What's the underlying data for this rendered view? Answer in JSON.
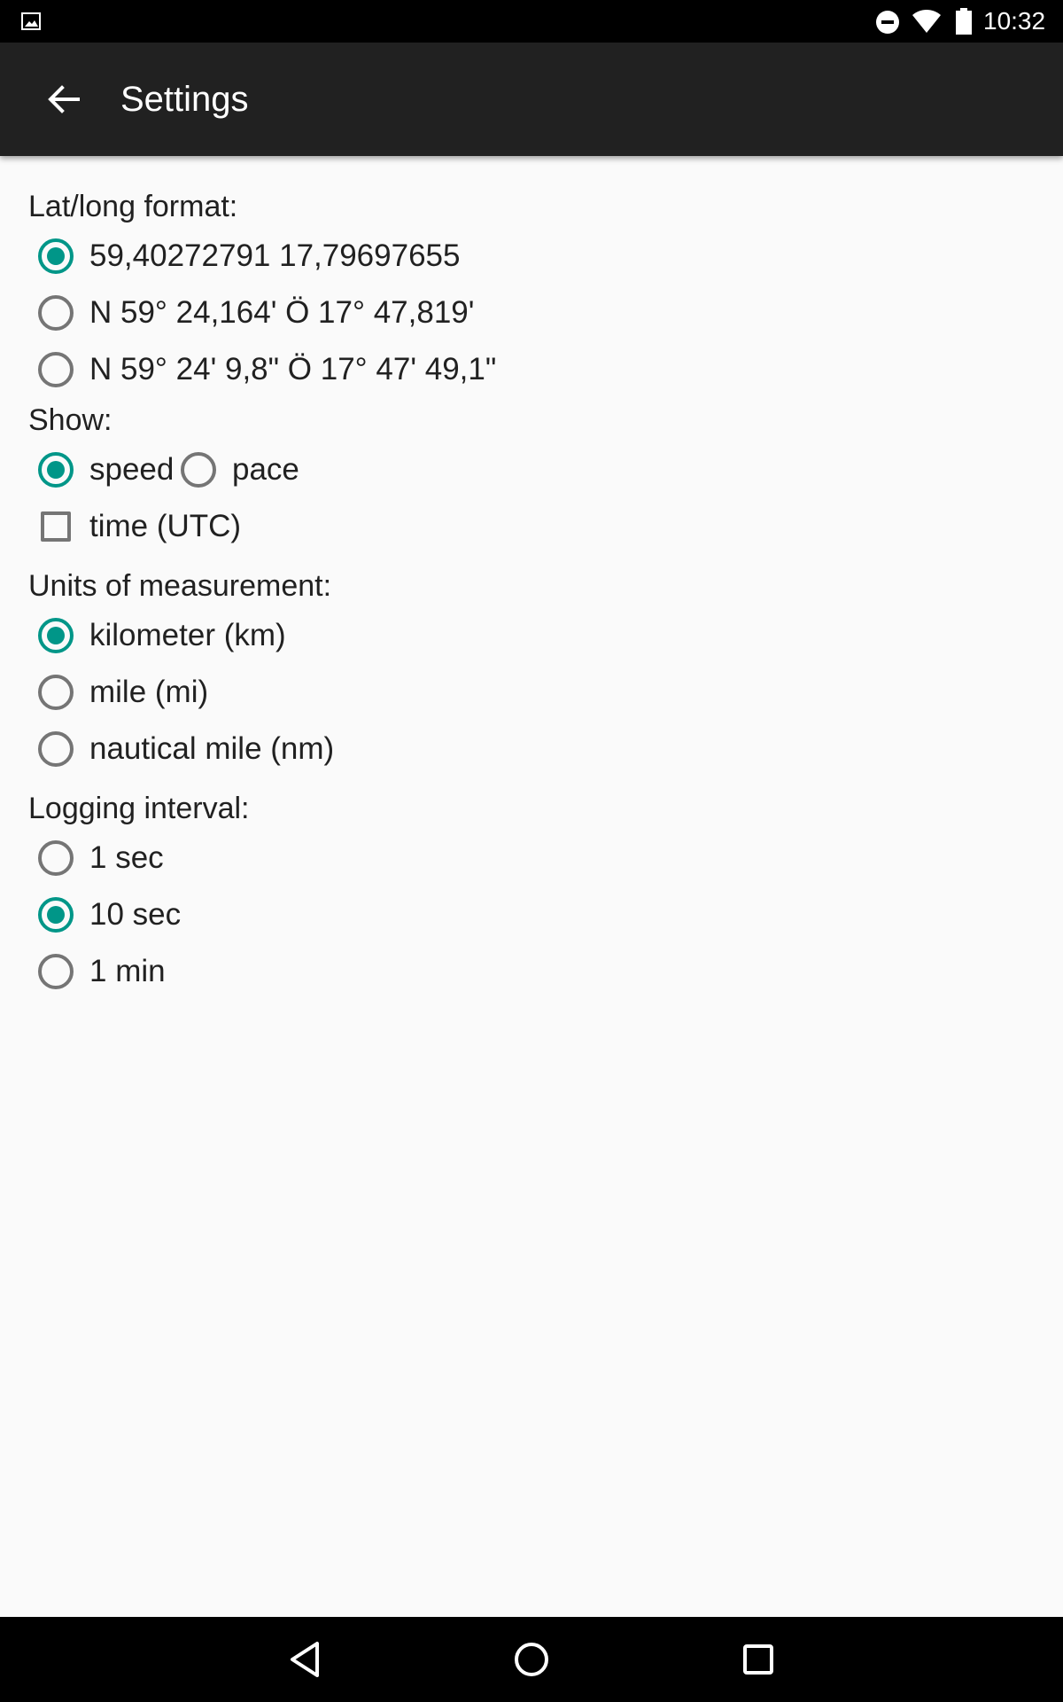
{
  "status_bar": {
    "time": "10:32",
    "icons": [
      "image-notification-icon",
      "do-not-disturb-icon",
      "wifi-icon",
      "battery-icon"
    ]
  },
  "toolbar": {
    "title": "Settings",
    "back_icon": "arrow-back-icon"
  },
  "colors": {
    "accent": "#009688",
    "toolbar_bg": "#212121",
    "background": "#fafafa",
    "text": "#212121",
    "unchecked": "#757575"
  },
  "settings": {
    "latlong": {
      "label": "Lat/long format:",
      "options": [
        {
          "label": "59,40272791 17,79697655",
          "checked": true
        },
        {
          "label": "N 59° 24,164' Ö 17° 47,819'",
          "checked": false
        },
        {
          "label": "N 59° 24' 9,8\" Ö 17° 47' 49,1\"",
          "checked": false
        }
      ]
    },
    "show": {
      "label": "Show:",
      "speed": {
        "label": "speed",
        "checked": true
      },
      "pace": {
        "label": "pace",
        "checked": false
      },
      "time_utc": {
        "label": "time (UTC)",
        "checked": false
      }
    },
    "units": {
      "label": "Units of measurement:",
      "options": [
        {
          "label": "kilometer (km)",
          "checked": true
        },
        {
          "label": "mile (mi)",
          "checked": false
        },
        {
          "label": "nautical mile (nm)",
          "checked": false
        }
      ]
    },
    "logging": {
      "label": "Logging interval:",
      "options": [
        {
          "label": "1 sec",
          "checked": false
        },
        {
          "label": "10 sec",
          "checked": true
        },
        {
          "label": "1 min",
          "checked": false
        }
      ]
    }
  },
  "nav_bar": {
    "icons": [
      "back-triangle-icon",
      "home-circle-icon",
      "recents-square-icon"
    ]
  }
}
